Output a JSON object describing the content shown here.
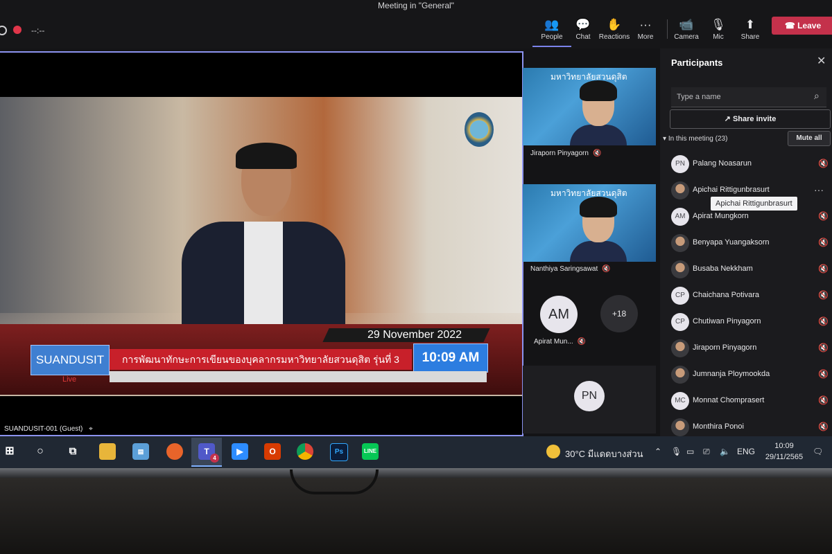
{
  "window": {
    "title": "Meeting in \"General\"",
    "recording_time": "--:--"
  },
  "toolbar": {
    "people": "People",
    "chat": "Chat",
    "reactions": "Reactions",
    "more": "More",
    "camera": "Camera",
    "mic": "Mic",
    "share": "Share",
    "leave": "Leave"
  },
  "stage": {
    "broadcast_date": "29 November 2022",
    "brand": "SUANDUSIT",
    "headline": "การพัฒนาทักษะการเขียนของบุคลากรมหาวิทยาลัยสวนดุสิต รุ่นที่ 3",
    "time": "10:09 AM",
    "live": "Live",
    "participant_name": "SUANDUSIT-001 (Guest)"
  },
  "tiles": [
    {
      "banner": "มหาวิทยาลัยสวนดุสิต",
      "name": "Jiraporn Pinyagorn"
    },
    {
      "banner": "มหาวิทยาลัยสวนดุสิต",
      "name": "Nanthiya Saringsawat"
    }
  ],
  "avatar_tiles": {
    "am_initials": "AM",
    "am_name": "Apirat Mun...",
    "more_count": "+18",
    "pn_initials": "PN"
  },
  "participants_panel": {
    "title": "Participants",
    "search_placeholder": "Type a name",
    "share_invite": "Share invite",
    "in_meeting": "In this meeting (23)",
    "mute_all": "Mute all",
    "tooltip": "Apichai Rittigunbrasurt",
    "people": [
      {
        "initials": "PN",
        "name": "Palang Noasarun"
      },
      {
        "initials": "",
        "name": "Apichai Rittigunbrasurt"
      },
      {
        "initials": "AM",
        "name": "Apirat Mungkorn"
      },
      {
        "initials": "",
        "name": "Benyapa Yuangaksorn"
      },
      {
        "initials": "",
        "name": "Busaba Nekkham"
      },
      {
        "initials": "CP",
        "name": "Chaichana Potivara"
      },
      {
        "initials": "CP",
        "name": "Chutiwan Pinyagorn"
      },
      {
        "initials": "",
        "name": "Jiraporn Pinyagorn"
      },
      {
        "initials": "",
        "name": "Jumnanja Ploymookda"
      },
      {
        "initials": "MC",
        "name": "Monnat Chomprasert"
      },
      {
        "initials": "",
        "name": "Monthira Ponoi"
      }
    ]
  },
  "taskbar": {
    "teams_badge": "4",
    "weather": "30°C มีแดดบางส่วน",
    "language": "ENG",
    "time": "10:09",
    "date": "29/11/2565"
  },
  "colors": {
    "accent": "#7b83eb",
    "leave": "#c4314b",
    "brand_blue": "#3f7fd1",
    "headline_red": "#c8202a"
  }
}
